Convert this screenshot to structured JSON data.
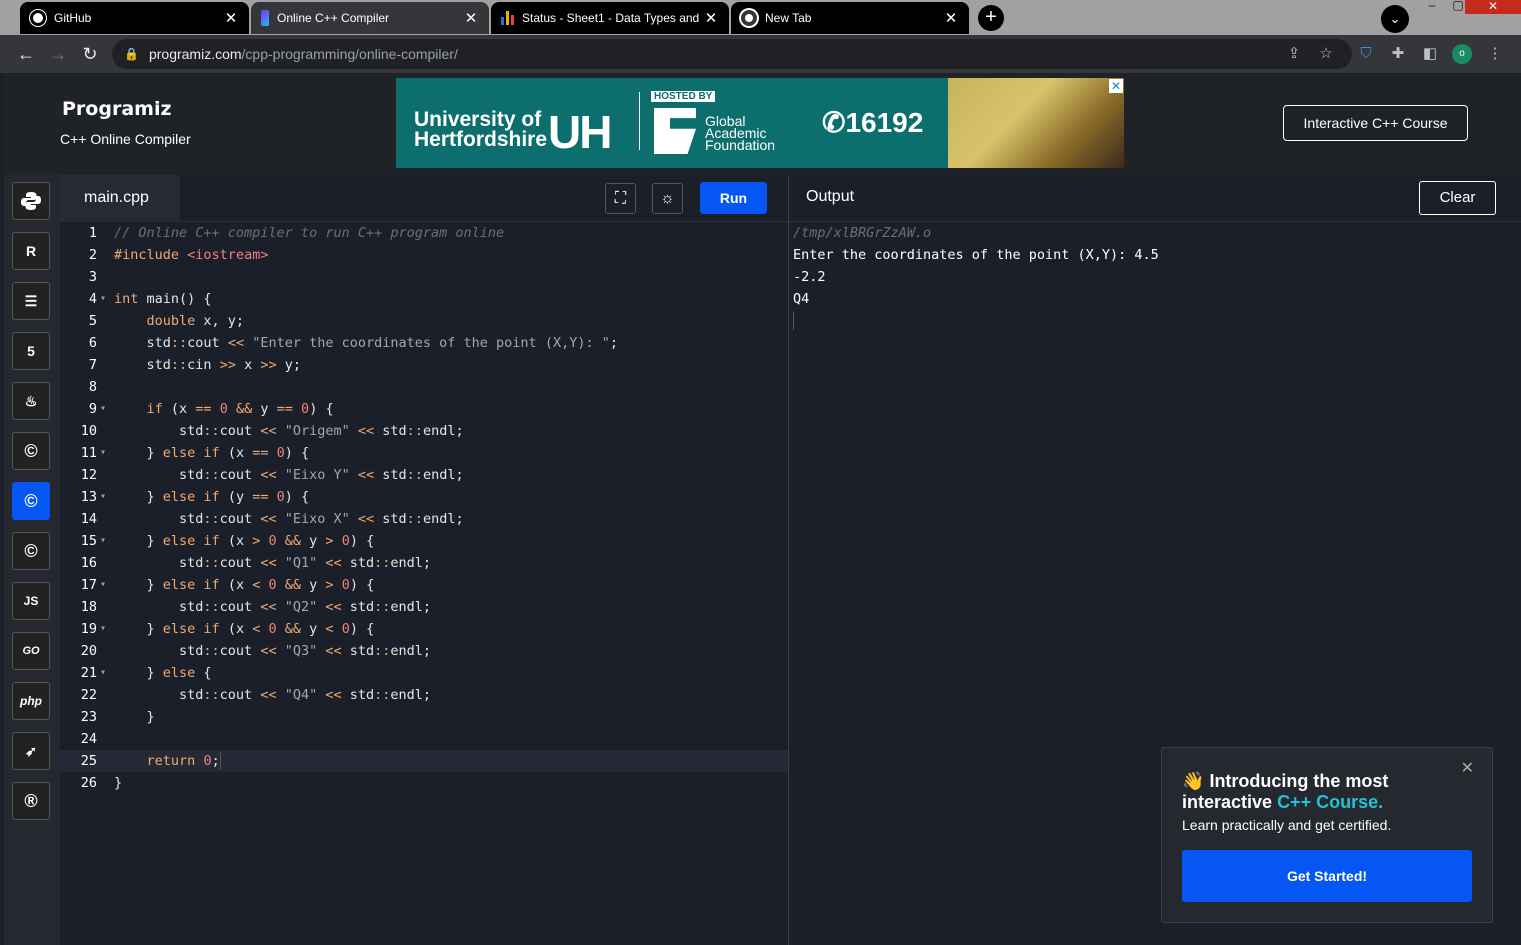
{
  "browser": {
    "tabs": [
      {
        "title": "GitHub",
        "icon": "github-icon"
      },
      {
        "title": "Online C++ Compiler",
        "icon": "programiz-icon"
      },
      {
        "title": "Status - Sheet1 - Data Types and",
        "icon": "chart-icon"
      },
      {
        "title": "New Tab",
        "icon": "chrome-icon"
      }
    ],
    "url_host": "programiz.com",
    "url_path": "/cpp-programming/online-compiler/",
    "profile_initial": "o"
  },
  "header": {
    "logo": "Programiz",
    "subtitle": "C++ Online Compiler",
    "course_button": "Interactive C++ Course",
    "ad": {
      "university_line1": "University of",
      "university_line2": "Hertfordshire",
      "uh": "UH",
      "hosted_by": "HOSTED BY",
      "global_line1": "Global",
      "global_line2": "Academic",
      "global_line3": "Foundation",
      "phone": "16192"
    }
  },
  "sidebar": {
    "languages": [
      "Python",
      "R",
      "SQL",
      "HTML",
      "Java",
      "C",
      "C++",
      "C#",
      "JS",
      "GO",
      "php",
      "Swift",
      "Rust"
    ],
    "labels": {
      "js": "JS",
      "go": "GO",
      "php": "php"
    }
  },
  "editor": {
    "file_tab": "main.cpp",
    "run_label": "Run",
    "line_numbers": [
      "1",
      "2",
      "3",
      "4",
      "5",
      "6",
      "7",
      "8",
      "9",
      "10",
      "11",
      "12",
      "13",
      "14",
      "15",
      "16",
      "17",
      "18",
      "19",
      "20",
      "21",
      "22",
      "23",
      "24",
      "25",
      "26"
    ]
  },
  "output": {
    "title": "Output",
    "clear_label": "Clear",
    "lines": [
      "/tmp/xlBRGrZzAW.o",
      "Enter the coordinates of the point (X,Y): 4.5",
      "-2.2",
      "Q4"
    ]
  },
  "popup": {
    "emoji": "👋",
    "heading_part1": "Introducing the most interactive",
    "heading_accent": "C++ Course.",
    "subtext": "Learn practically and get certified.",
    "button": "Get Started!"
  },
  "colors": {
    "accent": "#0556f3",
    "background": "#1b1f29",
    "keyword": "#f1a96e",
    "string": "#a6a6a6",
    "number": "#f08080",
    "popup_accent": "#25c1d4"
  }
}
